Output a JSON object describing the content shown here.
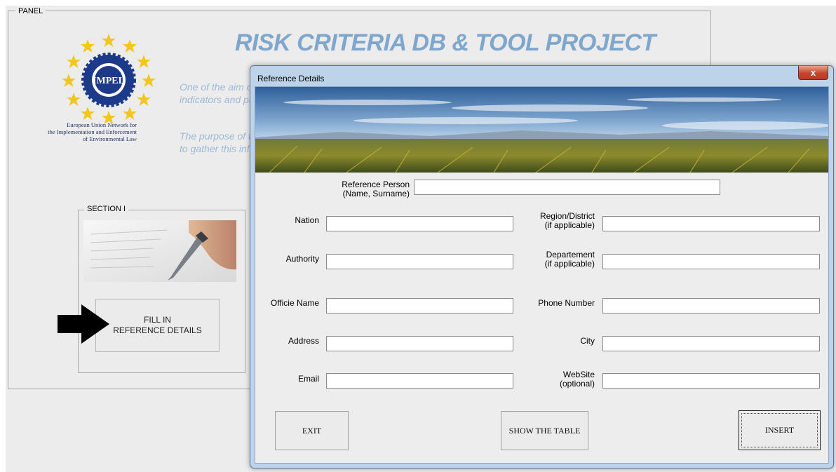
{
  "panel": {
    "legend": "PANEL",
    "title": "RISK CRITERIA DB & TOOL PROJECT",
    "description": [
      "One of the aim o",
      "indicators and pa",
      "The purpose of t",
      "to gather this info"
    ],
    "logo": {
      "emblem_text": "IMPEL",
      "caption": [
        "European Union Network for",
        "the Implementation and Enforcement",
        "of Environmental Law"
      ]
    },
    "section": {
      "legend": "SECTION I",
      "fill_button_lines": [
        "FILL IN",
        "REFERENCE DETAILS"
      ]
    }
  },
  "dialog": {
    "title": "Reference Details",
    "close_glyph": "x",
    "reference_person": {
      "label_lines": [
        "Reference Person",
        "(Name, Surname)"
      ],
      "value": ""
    },
    "left_fields": [
      {
        "label_lines": [
          "Nation"
        ],
        "value": ""
      },
      {
        "label_lines": [
          "Authority"
        ],
        "value": ""
      },
      {
        "label_lines": [
          "Officie Name"
        ],
        "value": ""
      },
      {
        "label_lines": [
          "Address"
        ],
        "value": ""
      },
      {
        "label_lines": [
          "Email"
        ],
        "value": ""
      }
    ],
    "right_fields": [
      {
        "label_lines": [
          "Region/District",
          "(if applicable)"
        ],
        "value": ""
      },
      {
        "label_lines": [
          "Departement",
          "(if applicable)"
        ],
        "value": ""
      },
      {
        "label_lines": [
          "Phone Number"
        ],
        "value": ""
      },
      {
        "label_lines": [
          "City"
        ],
        "value": ""
      },
      {
        "label_lines": [
          "WebSite",
          "(optional)"
        ],
        "value": ""
      }
    ],
    "buttons": {
      "exit": "EXIT",
      "show_table": "SHOW THE TABLE",
      "insert": "INSERT"
    }
  },
  "colors": {
    "title_blue": "#7fa6cd",
    "description_blue": "#9cb9d6",
    "dialog_frame": "#bcd3ea",
    "close_red": "#c8452f",
    "emblem_blue": "#1d3a8a",
    "star_gold": "#f3c61c"
  }
}
